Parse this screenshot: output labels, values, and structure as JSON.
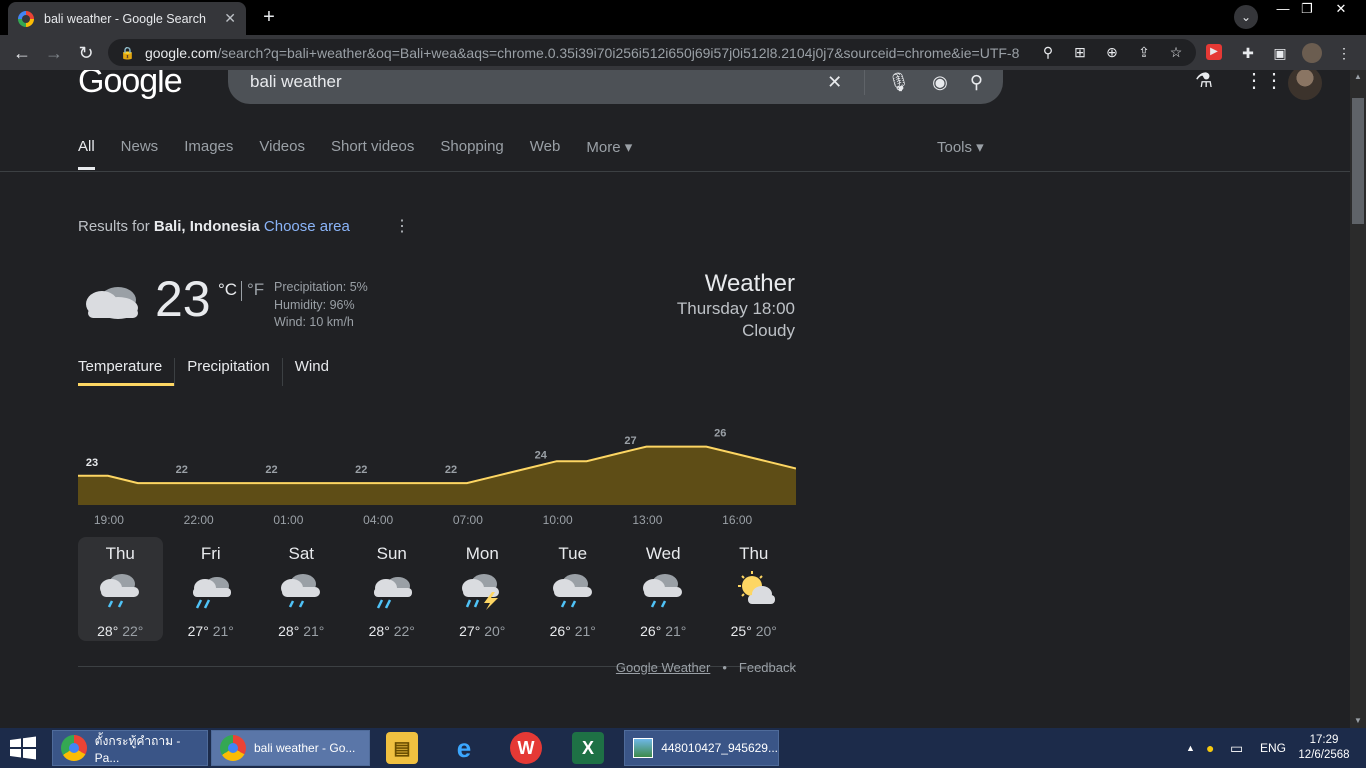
{
  "browser": {
    "tab_title": "bali weather - Google Search",
    "tab_close": "✕",
    "new_tab": "+",
    "url_host": "google.com",
    "url_rest": "/search?q=bali+weather&oq=Bali+wea&aqs=chrome.0.35i39i70i256i512i650j69i57j0i512l8.2104j0j7&sourceid=chrome&ie=UTF-8"
  },
  "search": {
    "logo": "Google",
    "query": "bali weather"
  },
  "nav_tabs": [
    "All",
    "News",
    "Images",
    "Videos",
    "Short videos",
    "Shopping",
    "Web",
    "More ▾"
  ],
  "tools_label": "Tools ▾",
  "results_for": {
    "prefix": "Results for",
    "place": "Bali, Indonesia",
    "choose": "Choose area"
  },
  "weather": {
    "temp": "23",
    "unit_c": "°C",
    "unit_f": "°F",
    "precipitation": "Precipitation: 5%",
    "humidity": "Humidity: 96%",
    "wind": "Wind: 10 km/h",
    "title": "Weather",
    "time": "Thursday 18:00",
    "condition": "Cloudy"
  },
  "metric_tabs": [
    "Temperature",
    "Precipitation",
    "Wind"
  ],
  "chart_data": {
    "type": "area",
    "title": "",
    "x": [
      "18:00",
      "19:00",
      "20:00",
      "21:00",
      "22:00",
      "23:00",
      "00:00",
      "01:00",
      "02:00",
      "03:00",
      "04:00",
      "05:00",
      "06:00",
      "07:00",
      "08:00",
      "09:00",
      "10:00",
      "11:00",
      "12:00",
      "13:00",
      "14:00",
      "15:00",
      "16:00",
      "17:00",
      "18:00"
    ],
    "values": [
      23,
      23,
      22,
      22,
      22,
      22,
      22,
      22,
      22,
      22,
      22,
      22,
      22,
      22,
      23,
      24,
      25,
      25,
      26,
      27,
      27,
      27,
      26,
      25,
      24
    ],
    "value_labels": [
      {
        "hour": "18:00",
        "label": "23"
      },
      {
        "hour": "21:00",
        "label": "22"
      },
      {
        "hour": "00:00",
        "label": "22"
      },
      {
        "hour": "03:00",
        "label": "22"
      },
      {
        "hour": "06:00",
        "label": "22"
      },
      {
        "hour": "09:00",
        "label": "24"
      },
      {
        "hour": "12:00",
        "label": "27"
      },
      {
        "hour": "15:00",
        "label": "26"
      }
    ],
    "tick_labels": [
      "19:00",
      "22:00",
      "01:00",
      "04:00",
      "07:00",
      "10:00",
      "13:00",
      "16:00"
    ],
    "line_color": "#fdd663",
    "fill_color": "#5e4d16"
  },
  "forecast": [
    {
      "day": "Thu",
      "icon": "rain-cloud-icon",
      "hi": "28°",
      "lo": "22°"
    },
    {
      "day": "Fri",
      "icon": "sun-rain-cloud-icon",
      "hi": "27°",
      "lo": "21°"
    },
    {
      "day": "Sat",
      "icon": "rain-cloud-icon",
      "hi": "28°",
      "lo": "21°"
    },
    {
      "day": "Sun",
      "icon": "sun-rain-cloud-icon",
      "hi": "28°",
      "lo": "22°"
    },
    {
      "day": "Mon",
      "icon": "thunderstorm-icon",
      "hi": "27°",
      "lo": "20°"
    },
    {
      "day": "Tue",
      "icon": "rain-cloud-icon",
      "hi": "26°",
      "lo": "21°"
    },
    {
      "day": "Wed",
      "icon": "rain-cloud-icon",
      "hi": "26°",
      "lo": "21°"
    },
    {
      "day": "Thu",
      "icon": "partly-cloudy-icon",
      "hi": "25°",
      "lo": "20°"
    }
  ],
  "footer": {
    "google_weather": "Google Weather",
    "dot": "•",
    "feedback": "Feedback"
  },
  "taskbar": {
    "app1": "ตั้งกระทู้คำถาม - Pa...",
    "app2": "bali weather - Go...",
    "app3": "448010427_945629...",
    "lang": "ENG",
    "time": "17:29",
    "date": "12/6/2568"
  }
}
